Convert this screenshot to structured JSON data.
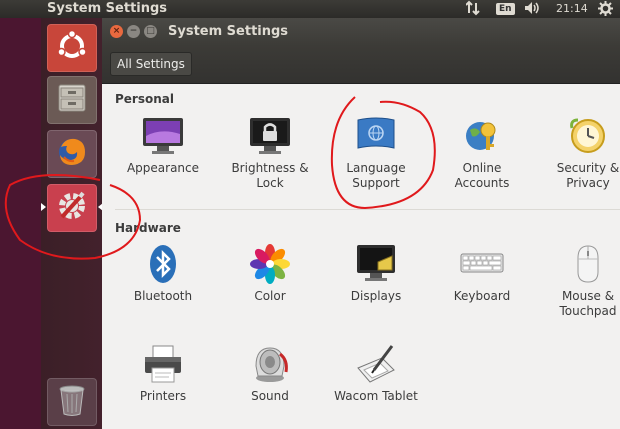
{
  "top_panel": {
    "title": "System Settings",
    "keyboard_layout": "En",
    "time": "21:14"
  },
  "window": {
    "title": "System Settings",
    "close_symbol": "×",
    "min_symbol": "−",
    "max_symbol": "□",
    "all_settings_label": "All Settings"
  },
  "sections": {
    "personal": {
      "title": "Personal",
      "items": [
        {
          "line1": "Appearance",
          "line2": ""
        },
        {
          "line1": "Brightness &",
          "line2": "Lock"
        },
        {
          "line1": "Language",
          "line2": "Support"
        },
        {
          "line1": "Online",
          "line2": "Accounts"
        },
        {
          "line1": "Security &",
          "line2": "Privacy"
        }
      ]
    },
    "hardware": {
      "title": "Hardware",
      "items": [
        {
          "line1": "Bluetooth",
          "line2": ""
        },
        {
          "line1": "Color",
          "line2": ""
        },
        {
          "line1": "Displays",
          "line2": ""
        },
        {
          "line1": "Keyboard",
          "line2": ""
        },
        {
          "line1": "Mouse &",
          "line2": "Touchpad"
        },
        {
          "line1": "Printers",
          "line2": ""
        },
        {
          "line1": "Sound",
          "line2": ""
        },
        {
          "line1": "Wacom Tablet",
          "line2": ""
        }
      ]
    }
  },
  "launcher": [
    "ubuntu-dash-icon",
    "files-icon",
    "firefox-icon",
    "system-settings-icon",
    "trash-icon"
  ],
  "colors": {
    "accent": "#e9693f",
    "annotation": "#e0191c",
    "launcher_active": "#c9404e"
  }
}
